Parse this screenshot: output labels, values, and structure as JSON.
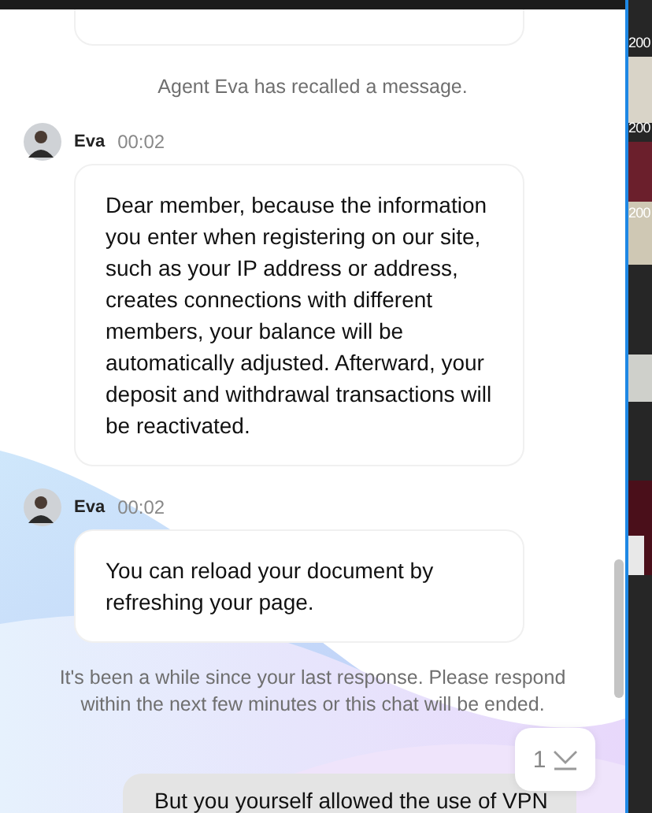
{
  "chat": {
    "items": [
      {
        "kind": "system",
        "text": "Agent Eva has recalled a message."
      },
      {
        "kind": "agent",
        "name": "Eva",
        "time": "00:02",
        "text": "Dear member, because the information you enter when registering on our site, such as your IP address or address, creates connections with different members, your balance will be automatically adjusted. Afterward, your deposit and withdrawal transactions will be reactivated."
      },
      {
        "kind": "agent",
        "name": "Eva",
        "time": "00:02",
        "text": "You can reload your document by refreshing your page."
      },
      {
        "kind": "system",
        "text": "It's been a while since your last response. Please respond within the next few minutes or this chat will be ended."
      },
      {
        "kind": "user",
        "text": "But you yourself allowed the use of VPN"
      }
    ]
  },
  "new_messages": {
    "count": "1"
  },
  "background_window": {
    "labels": [
      "200",
      "200",
      "200"
    ]
  }
}
